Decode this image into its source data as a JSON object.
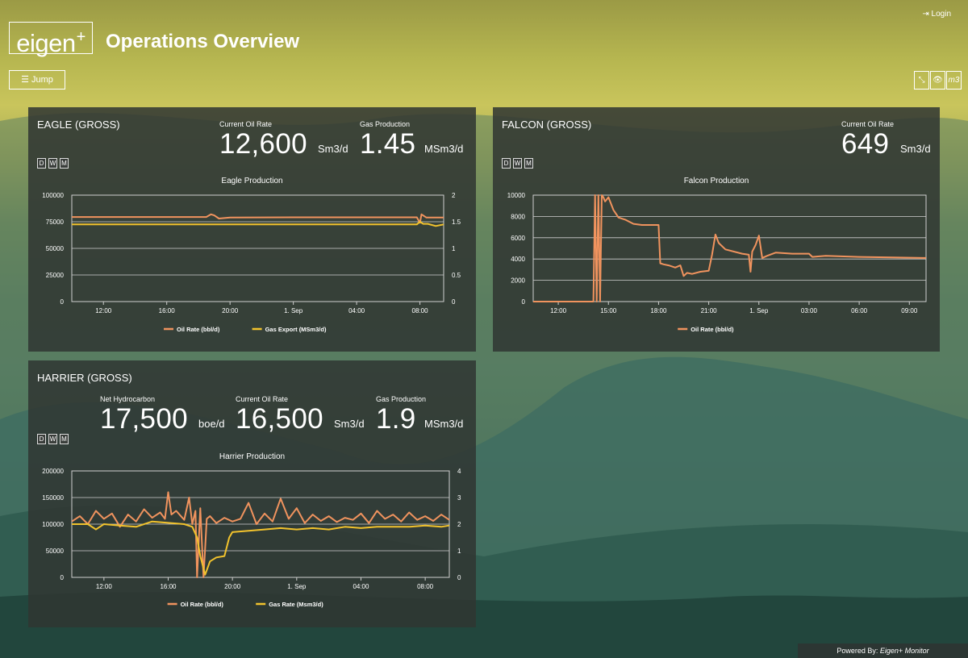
{
  "app": {
    "logo": "eigen",
    "logo_plus": "+",
    "title": "Operations Overview",
    "login": "Login",
    "jump": "Jump",
    "tools": [
      "⤡",
      "👁",
      "m3"
    ],
    "footer_prefix": "Powered By: ",
    "footer_brand": "Eigen+ Monitor"
  },
  "colors": {
    "oil": "#f0935e",
    "gas": "#f2c32d",
    "grid": "#d9d9d9"
  },
  "panels": {
    "eagle": {
      "title": "EAGLE (GROSS)",
      "kpis": [
        {
          "label": "Current Oil Rate",
          "value": "12,600",
          "unit": "Sm3/d"
        },
        {
          "label": "Gas Production",
          "value": "1.45",
          "unit": "MSm3/d"
        }
      ],
      "dwm": [
        "D",
        "W",
        "M"
      ],
      "chart_title": "Eagle Production",
      "legend": [
        "Oil Rate (bbl/d)",
        "Gas Export (MSm3/d)"
      ]
    },
    "falcon": {
      "title": "FALCON (GROSS)",
      "kpis": [
        {
          "label": "Current Oil Rate",
          "value": "649",
          "unit": "Sm3/d"
        }
      ],
      "dwm": [
        "D",
        "W",
        "M"
      ],
      "chart_title": "Falcon Production",
      "legend": [
        "Oil Rate (bbl/d)"
      ]
    },
    "harrier": {
      "title": "HARRIER (GROSS)",
      "kpis": [
        {
          "label": "Net Hydrocarbon",
          "value": "17,500",
          "unit": "boe/d"
        },
        {
          "label": "Current Oil Rate",
          "value": "16,500",
          "unit": "Sm3/d"
        },
        {
          "label": "Gas Production",
          "value": "1.9",
          "unit": "MSm3/d"
        }
      ],
      "dwm": [
        "D",
        "W",
        "M"
      ],
      "chart_title": "Harrier Production",
      "legend": [
        "Oil Rate (bbl/d)",
        "Gas Rate (Msm3/d)"
      ]
    }
  },
  "chart_data": [
    {
      "type": "line",
      "title": "Eagle Production",
      "x_ticks": [
        "12:00",
        "16:00",
        "20:00",
        "1. Sep",
        "04:00",
        "08:00"
      ],
      "x_tick_hours": [
        12,
        16,
        20,
        24,
        28,
        32
      ],
      "xlim_hours": [
        10,
        33.5
      ],
      "y_ticks": [
        "0",
        "25000",
        "50000",
        "75000",
        "100000"
      ],
      "ylim": [
        0,
        100000
      ],
      "y2_ticks": [
        "0",
        "0.5",
        "1",
        "1.5",
        "2"
      ],
      "y2lim": [
        0,
        2
      ],
      "series": [
        {
          "name": "Oil Rate (bbl/d)",
          "axis": "left",
          "color": "#f0935e",
          "x": [
            10,
            14,
            18.5,
            18.8,
            19.0,
            19.3,
            20,
            24,
            28,
            31.8,
            32.0,
            32.1,
            32.4,
            33.5
          ],
          "y": [
            79500,
            79500,
            79500,
            82000,
            81000,
            78000,
            79000,
            79200,
            79200,
            79200,
            74000,
            82000,
            79000,
            79000
          ]
        },
        {
          "name": "Gas Export (MSm3/d)",
          "axis": "right",
          "color": "#f2c32d",
          "x": [
            10,
            14,
            18,
            22,
            26,
            30,
            31.8,
            32.0,
            32.2,
            32.5,
            33,
            33.5
          ],
          "y": [
            1.45,
            1.45,
            1.45,
            1.45,
            1.45,
            1.45,
            1.45,
            1.5,
            1.46,
            1.46,
            1.42,
            1.45
          ]
        }
      ]
    },
    {
      "type": "line",
      "title": "Falcon Production",
      "x_ticks": [
        "12:00",
        "15:00",
        "18:00",
        "21:00",
        "1. Sep",
        "03:00",
        "06:00",
        "09:00"
      ],
      "x_tick_hours": [
        12,
        15,
        18,
        21,
        24,
        27,
        30,
        33
      ],
      "xlim_hours": [
        10.5,
        34
      ],
      "y_ticks": [
        "0",
        "2000",
        "4000",
        "6000",
        "8000",
        "10000"
      ],
      "ylim": [
        0,
        10000
      ],
      "series": [
        {
          "name": "Oil Rate (bbl/d)",
          "axis": "left",
          "color": "#f0935e",
          "x": [
            10.5,
            14.1,
            14.2,
            14.3,
            14.4,
            14.5,
            14.6,
            14.7,
            14.8,
            15.0,
            15.3,
            15.6,
            16.0,
            16.5,
            17.0,
            17.5,
            18.0,
            18.1,
            18.3,
            18.6,
            19.0,
            19.3,
            19.5,
            19.7,
            20.0,
            20.5,
            21.0,
            21.2,
            21.4,
            21.6,
            22.0,
            23.0,
            23.4,
            23.5,
            23.6,
            23.8,
            24.0,
            24.2,
            24.5,
            25.0,
            26.0,
            27.0,
            27.2,
            28.0,
            30.0,
            32.0,
            34.0
          ],
          "y": [
            0,
            0,
            10000,
            0,
            10000,
            0,
            10000,
            9800,
            9400,
            9800,
            8600,
            7900,
            7700,
            7300,
            7200,
            7200,
            7200,
            3600,
            3500,
            3400,
            3200,
            3400,
            2400,
            2700,
            2600,
            2800,
            2900,
            4400,
            6300,
            5500,
            4900,
            4500,
            4400,
            2800,
            4700,
            5300,
            6200,
            4100,
            4300,
            4600,
            4500,
            4500,
            4200,
            4300,
            4200,
            4150,
            4100
          ]
        }
      ]
    },
    {
      "type": "line",
      "title": "Harrier Production",
      "x_ticks": [
        "12:00",
        "16:00",
        "20:00",
        "1. Sep",
        "04:00",
        "08:00"
      ],
      "x_tick_hours": [
        12,
        16,
        20,
        24,
        28,
        32
      ],
      "xlim_hours": [
        10,
        33.5
      ],
      "y_ticks": [
        "0",
        "50000",
        "100000",
        "150000",
        "200000"
      ],
      "ylim": [
        0,
        200000
      ],
      "y2_ticks": [
        "0",
        "1",
        "2",
        "3",
        "4"
      ],
      "y2lim": [
        0,
        4
      ],
      "series": [
        {
          "name": "Oil Rate (bbl/d)",
          "axis": "left",
          "color": "#f0935e",
          "x": [
            10,
            10.5,
            11,
            11.5,
            12,
            12.5,
            13,
            13.5,
            14,
            14.5,
            15,
            15.5,
            15.8,
            16.0,
            16.2,
            16.5,
            17,
            17.3,
            17.5,
            17.7,
            17.8,
            18.0,
            18.2,
            18.4,
            18.6,
            19,
            19.5,
            20,
            20.5,
            21,
            21.5,
            22,
            22.5,
            23,
            23.5,
            24,
            24.5,
            25,
            25.5,
            26,
            26.5,
            27,
            27.5,
            28,
            28.5,
            29,
            29.5,
            30,
            30.5,
            31,
            31.5,
            32,
            32.5,
            33,
            33.5
          ],
          "y": [
            105000,
            115000,
            100000,
            125000,
            110000,
            120000,
            95000,
            118000,
            105000,
            128000,
            112000,
            122000,
            110000,
            160000,
            118000,
            125000,
            108000,
            150000,
            100000,
            125000,
            0,
            130000,
            0,
            110000,
            115000,
            102000,
            112000,
            105000,
            110000,
            140000,
            100000,
            120000,
            105000,
            148000,
            110000,
            130000,
            102000,
            118000,
            106000,
            115000,
            104000,
            112000,
            108000,
            120000,
            102000,
            125000,
            110000,
            118000,
            105000,
            122000,
            108000,
            115000,
            106000,
            118000,
            108000
          ]
        },
        {
          "name": "Gas Rate (Msm3/d)",
          "axis": "right",
          "color": "#f2c32d",
          "x": [
            10,
            11,
            11.5,
            12,
            13,
            14,
            15,
            16,
            17,
            17.5,
            17.8,
            18.0,
            18.3,
            18.6,
            19,
            19.5,
            19.8,
            20,
            21,
            22,
            23,
            24,
            25,
            26,
            27,
            28,
            29,
            30,
            31,
            32,
            33,
            33.5
          ],
          "y": [
            2.0,
            2.0,
            1.8,
            2.0,
            1.95,
            1.9,
            2.1,
            2.05,
            2.0,
            1.9,
            1.5,
            0.8,
            0.1,
            0.6,
            0.75,
            0.8,
            1.5,
            1.7,
            1.75,
            1.8,
            1.85,
            1.8,
            1.85,
            1.8,
            1.9,
            1.85,
            1.9,
            1.9,
            1.9,
            1.95,
            1.9,
            1.95
          ]
        }
      ]
    }
  ]
}
